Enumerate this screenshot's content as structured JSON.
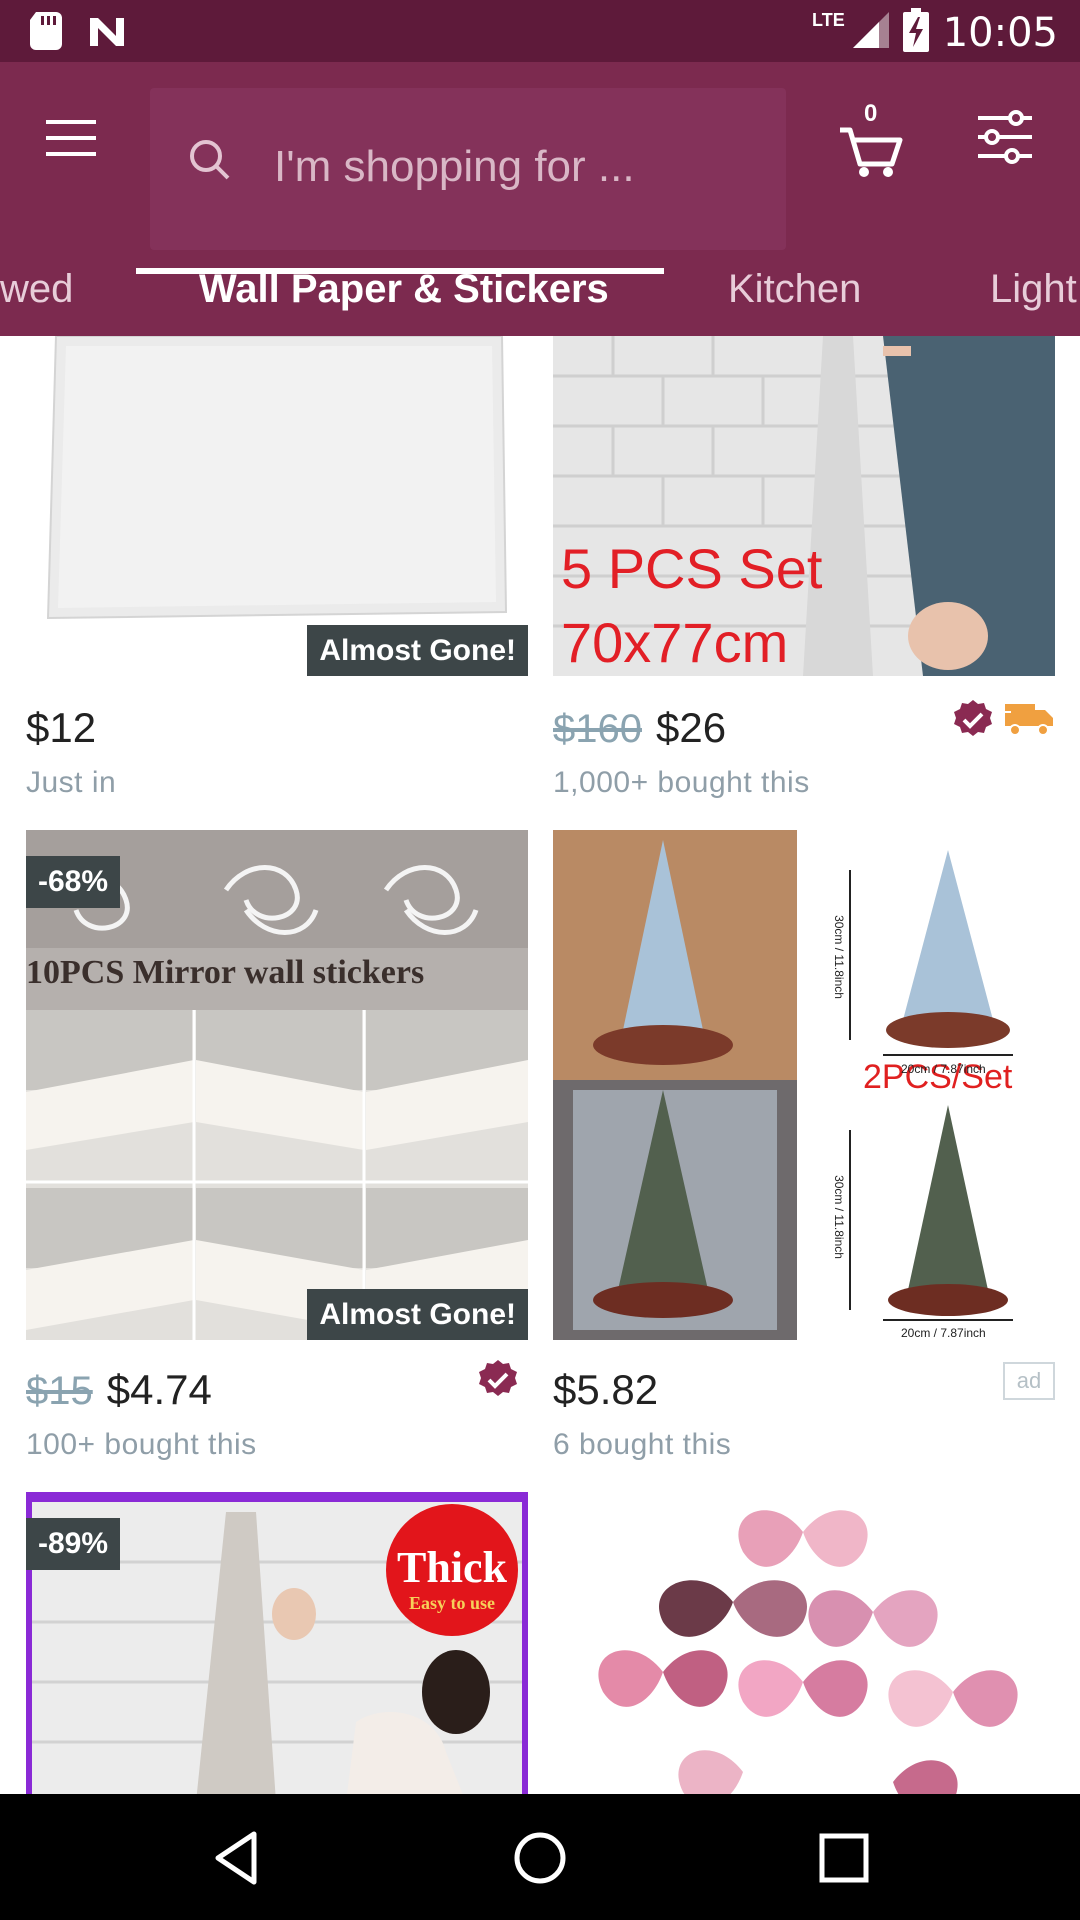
{
  "status_bar": {
    "network": "LTE",
    "time": "10:05",
    "icons": [
      "sd-card-icon",
      "n-notification-icon",
      "signal-icon",
      "battery-charging-icon"
    ]
  },
  "header": {
    "search_placeholder": "I'm shopping for ...",
    "cart_count": "0",
    "icons": [
      "menu-icon",
      "search-icon",
      "cart-icon",
      "filter-icon"
    ]
  },
  "tabs": [
    {
      "label": "wed",
      "active": false
    },
    {
      "label": "Wall Paper & Stickers",
      "active": true
    },
    {
      "label": "Kitchen",
      "active": false
    },
    {
      "label": "Light",
      "active": false
    }
  ],
  "products": [
    {
      "price": "$12",
      "old_price": "",
      "subtext": "Just in",
      "badge": "Almost Gone!",
      "discount": "",
      "verified": false,
      "shipping": false,
      "ad": false
    },
    {
      "price": "$26",
      "old_price": "$160",
      "subtext": "1,000+ bought this",
      "badge": "",
      "discount": "",
      "image_text": [
        "5 PCS Set",
        "70x77cm"
      ],
      "verified": true,
      "shipping": true,
      "ad": false
    },
    {
      "price": "$4.74",
      "old_price": "$15",
      "subtext": "100+ bought this",
      "badge": "Almost Gone!",
      "discount": "-68%",
      "image_text": [
        "10PCS Mirror wall stickers"
      ],
      "verified": true,
      "shipping": false,
      "ad": false
    },
    {
      "price": "$5.82",
      "old_price": "",
      "subtext": "6 bought this",
      "badge": "",
      "discount": "",
      "image_text": [
        "2PCS/Set",
        "20cm / 7.87inch",
        "30cm / 11.8inch"
      ],
      "verified": false,
      "shipping": false,
      "ad": true,
      "ad_label": "ad"
    },
    {
      "discount": "-89%",
      "image_text": [
        "Thick",
        "Easy to use"
      ]
    },
    {
      "discount": "",
      "image_text": []
    }
  ],
  "colors": {
    "status_bar": "#5e1a3a",
    "app_bar": "#7c2a4f",
    "accent": "#8a2a52",
    "shipping": "#f0a040"
  },
  "nav_bar": {
    "icons": [
      "back-icon",
      "home-icon",
      "recents-icon"
    ]
  }
}
